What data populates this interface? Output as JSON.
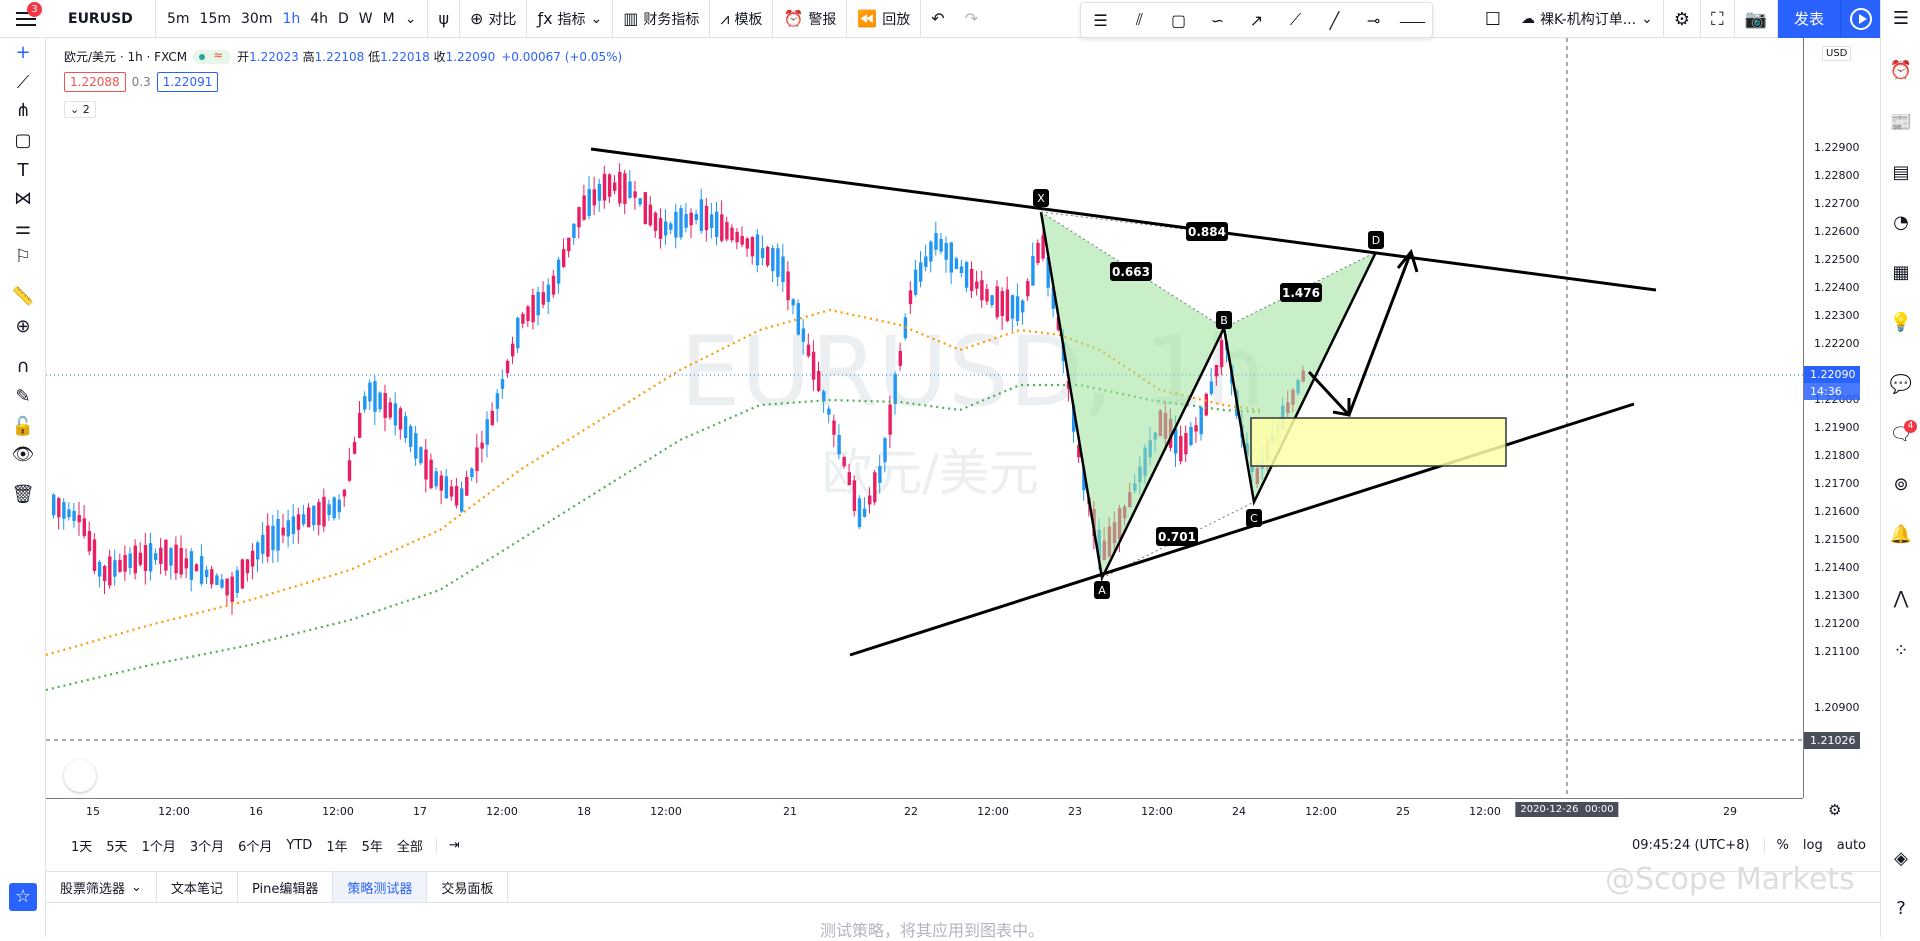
{
  "topbar": {
    "notifications": "3",
    "symbol": "EURUSD",
    "intervals": [
      "5m",
      "15m",
      "30m",
      "1h",
      "4h",
      "D",
      "W",
      "M"
    ],
    "compare": "对比",
    "indicators": "指标",
    "financials": "财务指标",
    "templates": "模板",
    "alert": "警报",
    "replay": "回放",
    "layout_name": "裸K-机构订单...",
    "publish": "发表"
  },
  "legend": {
    "title": "欧元/美元 · 1h · FXCM",
    "open_label": "开",
    "open": "1.22023",
    "high_label": "高",
    "high": "1.22108",
    "low_label": "低",
    "low": "1.22018",
    "close_label": "收",
    "close": "1.22090",
    "change": "+0.00067 (+0.05%)",
    "bid": "1.22088",
    "spread": "0.3",
    "ask": "1.22091",
    "collapse": "2"
  },
  "chart_watermark": {
    "symbol": "EURUSD, 1h",
    "description": "欧元/美元"
  },
  "price_scale": {
    "currency": "USD",
    "ticks": [
      "1.22900",
      "1.22800",
      "1.22700",
      "1.22600",
      "1.22500",
      "1.22400",
      "1.22300",
      "1.22200",
      "1.22000",
      "1.21900",
      "1.21800",
      "1.21700",
      "1.21600",
      "1.21500",
      "1.21400",
      "1.21300",
      "1.21200",
      "1.21100",
      "1.20900"
    ],
    "last_price": "1.22090",
    "countdown": "14:36",
    "crosshair_price": "1.21026",
    "colors": {
      "last": "#2962ff",
      "crosshair": "#4a4e5a"
    }
  },
  "time_scale": {
    "ticks": [
      "15",
      "12:00",
      "16",
      "12:00",
      "17",
      "12:00",
      "18",
      "12:00",
      "21",
      "22",
      "12:00",
      "23",
      "12:00",
      "24",
      "12:00",
      "25",
      "12:00",
      "29"
    ],
    "crosshair_date": "2020-12-26",
    "crosshair_time": "00:00"
  },
  "pattern": {
    "points": [
      "X",
      "A",
      "B",
      "C",
      "D"
    ],
    "ratios": [
      "0.884",
      "0.663",
      "1.476",
      "0.701"
    ]
  },
  "range_bar": {
    "ranges": [
      "1天",
      "5天",
      "1个月",
      "3个月",
      "6个月",
      "YTD",
      "1年",
      "5年",
      "全部"
    ],
    "clock": "09:45:24 (UTC+8)",
    "percent": "%",
    "log": "log",
    "auto": "auto"
  },
  "bottom_tabs": [
    "股票筛选器",
    "文本笔记",
    "Pine编辑器",
    "策略测试器",
    "交易面板"
  ],
  "strategy_message": "测试策略，将其应用到图表中。",
  "brand_watermark": "@Scope Markets",
  "right_badge": "4"
}
